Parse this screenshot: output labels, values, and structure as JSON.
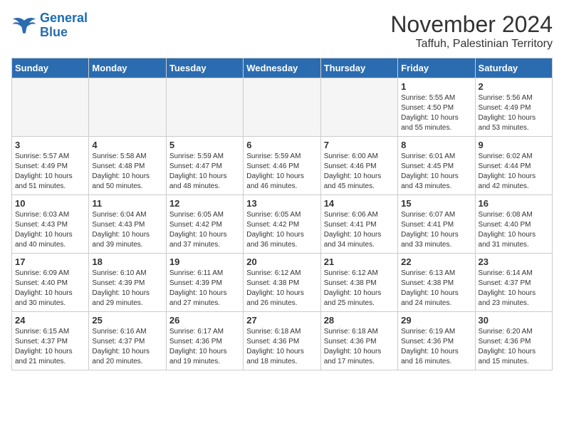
{
  "logo": {
    "line1": "General",
    "line2": "Blue"
  },
  "title": "November 2024",
  "subtitle": "Taffuh, Palestinian Territory",
  "headers": [
    "Sunday",
    "Monday",
    "Tuesday",
    "Wednesday",
    "Thursday",
    "Friday",
    "Saturday"
  ],
  "weeks": [
    [
      {
        "day": "",
        "info": ""
      },
      {
        "day": "",
        "info": ""
      },
      {
        "day": "",
        "info": ""
      },
      {
        "day": "",
        "info": ""
      },
      {
        "day": "",
        "info": ""
      },
      {
        "day": "1",
        "info": "Sunrise: 5:55 AM\nSunset: 4:50 PM\nDaylight: 10 hours and 55 minutes."
      },
      {
        "day": "2",
        "info": "Sunrise: 5:56 AM\nSunset: 4:49 PM\nDaylight: 10 hours and 53 minutes."
      }
    ],
    [
      {
        "day": "3",
        "info": "Sunrise: 5:57 AM\nSunset: 4:49 PM\nDaylight: 10 hours and 51 minutes."
      },
      {
        "day": "4",
        "info": "Sunrise: 5:58 AM\nSunset: 4:48 PM\nDaylight: 10 hours and 50 minutes."
      },
      {
        "day": "5",
        "info": "Sunrise: 5:59 AM\nSunset: 4:47 PM\nDaylight: 10 hours and 48 minutes."
      },
      {
        "day": "6",
        "info": "Sunrise: 5:59 AM\nSunset: 4:46 PM\nDaylight: 10 hours and 46 minutes."
      },
      {
        "day": "7",
        "info": "Sunrise: 6:00 AM\nSunset: 4:46 PM\nDaylight: 10 hours and 45 minutes."
      },
      {
        "day": "8",
        "info": "Sunrise: 6:01 AM\nSunset: 4:45 PM\nDaylight: 10 hours and 43 minutes."
      },
      {
        "day": "9",
        "info": "Sunrise: 6:02 AM\nSunset: 4:44 PM\nDaylight: 10 hours and 42 minutes."
      }
    ],
    [
      {
        "day": "10",
        "info": "Sunrise: 6:03 AM\nSunset: 4:43 PM\nDaylight: 10 hours and 40 minutes."
      },
      {
        "day": "11",
        "info": "Sunrise: 6:04 AM\nSunset: 4:43 PM\nDaylight: 10 hours and 39 minutes."
      },
      {
        "day": "12",
        "info": "Sunrise: 6:05 AM\nSunset: 4:42 PM\nDaylight: 10 hours and 37 minutes."
      },
      {
        "day": "13",
        "info": "Sunrise: 6:05 AM\nSunset: 4:42 PM\nDaylight: 10 hours and 36 minutes."
      },
      {
        "day": "14",
        "info": "Sunrise: 6:06 AM\nSunset: 4:41 PM\nDaylight: 10 hours and 34 minutes."
      },
      {
        "day": "15",
        "info": "Sunrise: 6:07 AM\nSunset: 4:41 PM\nDaylight: 10 hours and 33 minutes."
      },
      {
        "day": "16",
        "info": "Sunrise: 6:08 AM\nSunset: 4:40 PM\nDaylight: 10 hours and 31 minutes."
      }
    ],
    [
      {
        "day": "17",
        "info": "Sunrise: 6:09 AM\nSunset: 4:40 PM\nDaylight: 10 hours and 30 minutes."
      },
      {
        "day": "18",
        "info": "Sunrise: 6:10 AM\nSunset: 4:39 PM\nDaylight: 10 hours and 29 minutes."
      },
      {
        "day": "19",
        "info": "Sunrise: 6:11 AM\nSunset: 4:39 PM\nDaylight: 10 hours and 27 minutes."
      },
      {
        "day": "20",
        "info": "Sunrise: 6:12 AM\nSunset: 4:38 PM\nDaylight: 10 hours and 26 minutes."
      },
      {
        "day": "21",
        "info": "Sunrise: 6:12 AM\nSunset: 4:38 PM\nDaylight: 10 hours and 25 minutes."
      },
      {
        "day": "22",
        "info": "Sunrise: 6:13 AM\nSunset: 4:38 PM\nDaylight: 10 hours and 24 minutes."
      },
      {
        "day": "23",
        "info": "Sunrise: 6:14 AM\nSunset: 4:37 PM\nDaylight: 10 hours and 23 minutes."
      }
    ],
    [
      {
        "day": "24",
        "info": "Sunrise: 6:15 AM\nSunset: 4:37 PM\nDaylight: 10 hours and 21 minutes."
      },
      {
        "day": "25",
        "info": "Sunrise: 6:16 AM\nSunset: 4:37 PM\nDaylight: 10 hours and 20 minutes."
      },
      {
        "day": "26",
        "info": "Sunrise: 6:17 AM\nSunset: 4:36 PM\nDaylight: 10 hours and 19 minutes."
      },
      {
        "day": "27",
        "info": "Sunrise: 6:18 AM\nSunset: 4:36 PM\nDaylight: 10 hours and 18 minutes."
      },
      {
        "day": "28",
        "info": "Sunrise: 6:18 AM\nSunset: 4:36 PM\nDaylight: 10 hours and 17 minutes."
      },
      {
        "day": "29",
        "info": "Sunrise: 6:19 AM\nSunset: 4:36 PM\nDaylight: 10 hours and 16 minutes."
      },
      {
        "day": "30",
        "info": "Sunrise: 6:20 AM\nSunset: 4:36 PM\nDaylight: 10 hours and 15 minutes."
      }
    ]
  ]
}
